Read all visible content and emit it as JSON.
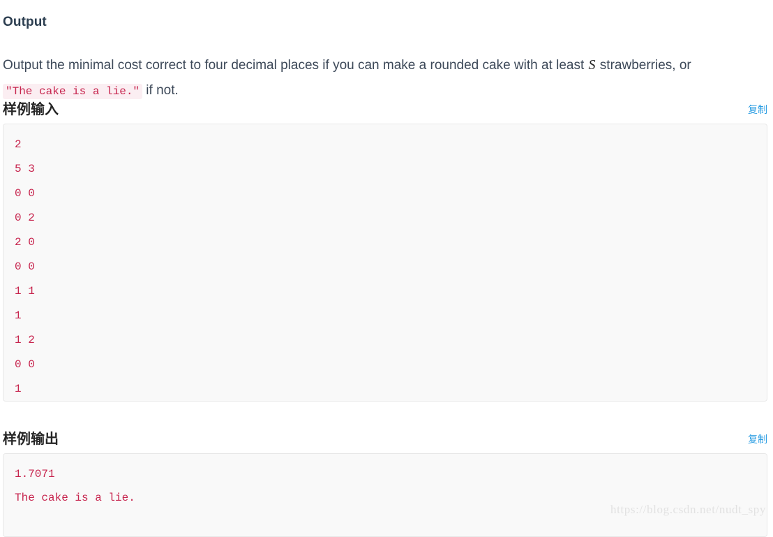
{
  "section": {
    "title": "Output",
    "paragraph": {
      "text_before_var": "Output the minimal cost correct to four decimal places if you can make a rounded cake with at least ",
      "variable": "S",
      "text_between": " strawberries, or ",
      "inline_code": "\"The cake is a lie.\"",
      "text_after": " if not."
    }
  },
  "sample_input": {
    "label": "样例输入",
    "copy_label": "复制",
    "content": "2\n5 3\n0 0\n0 2\n2 0\n0 0\n1 1\n1\n1 2\n0 0\n1"
  },
  "sample_output": {
    "label": "样例输出",
    "copy_label": "复制",
    "content": "1.7071\nThe cake is a lie."
  },
  "watermark": {
    "text": "https://blog.csdn.net/nudt_spy"
  },
  "colors": {
    "code_text": "#c7254e",
    "inline_code_bg": "#fbeef2",
    "link": "#2f9fe3",
    "body_text": "#3c4858",
    "code_box_bg": "#f9f9f9",
    "code_box_border": "#e8e8e8",
    "watermark": "#e2e2e2"
  }
}
